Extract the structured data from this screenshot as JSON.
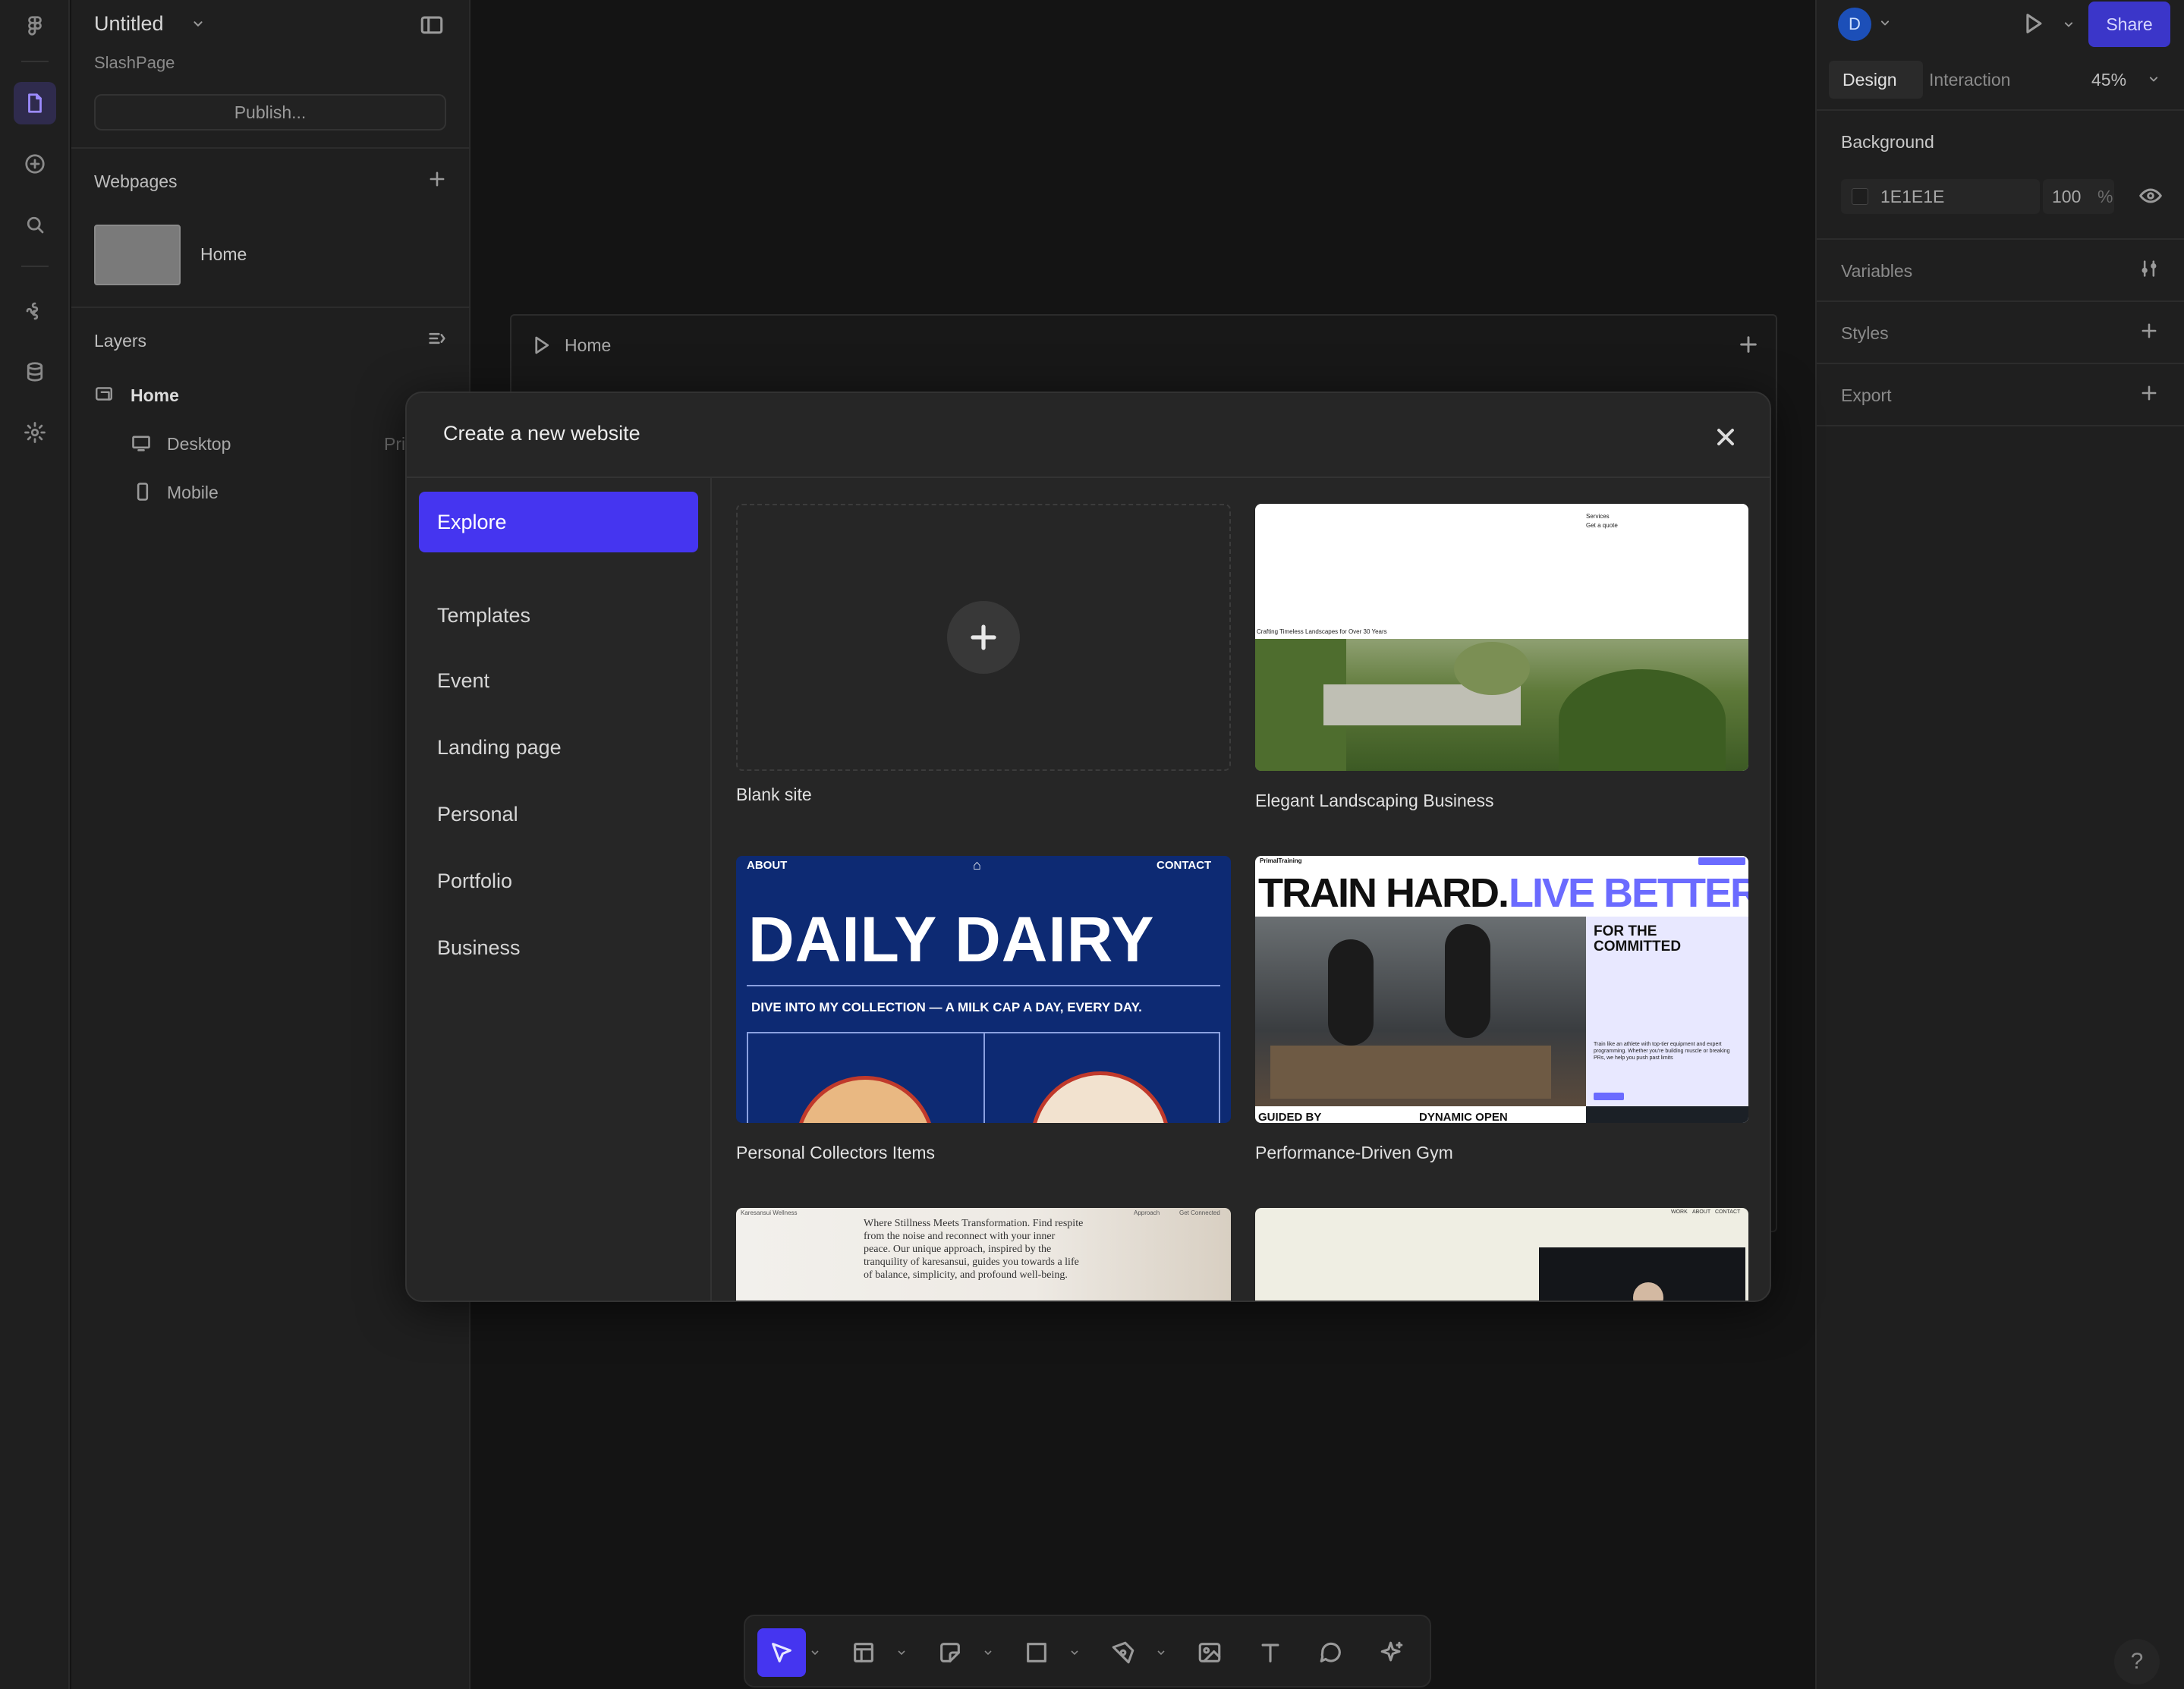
{
  "file": {
    "title": "Untitled",
    "team": "SlashPage",
    "publish_label": "Publish..."
  },
  "webpages": {
    "heading": "Webpages",
    "items": [
      {
        "label": "Home"
      }
    ]
  },
  "layers": {
    "heading": "Layers",
    "root": "Home",
    "children": [
      {
        "label": "Desktop",
        "badge": "Pri"
      },
      {
        "label": "Mobile"
      }
    ]
  },
  "right_panel": {
    "avatar_initial": "D",
    "share_label": "Share",
    "tabs": [
      {
        "label": "Design"
      },
      {
        "label": "Interaction"
      }
    ],
    "zoom": "45%",
    "background": {
      "heading": "Background",
      "hex": "1E1E1E",
      "opacity": "100",
      "unit": "%"
    },
    "sections": [
      {
        "label": "Variables"
      },
      {
        "label": "Styles"
      },
      {
        "label": "Export"
      }
    ]
  },
  "canvas": {
    "frame_label": "Home"
  },
  "modal": {
    "title": "Create a new website",
    "categories": [
      {
        "label": "Explore"
      },
      {
        "label": "Templates"
      },
      {
        "label": "Event"
      },
      {
        "label": "Landing page"
      },
      {
        "label": "Personal"
      },
      {
        "label": "Portfolio"
      },
      {
        "label": "Business"
      }
    ],
    "cards": [
      {
        "label": "Blank site"
      },
      {
        "label": "Elegant Landscaping Business"
      },
      {
        "label": "Personal Collectors Items"
      },
      {
        "label": "Performance-Driven Gym"
      }
    ],
    "previews": {
      "landscaping": {
        "nav1": "Services",
        "nav2": "Get a quote",
        "tagline": "Crafting Timeless Landscapes for Over 30 Years"
      },
      "dairy": {
        "about": "ABOUT",
        "contact": "CONTACT",
        "headline": "DAILY DAIRY",
        "subline": "DIVE INTO MY COLLECTION — A MILK CAP A DAY, EVERY DAY."
      },
      "gym": {
        "brand": "PrimalTraining",
        "headline_a": "TRAIN HARD.",
        "headline_b": "LIVE BETTER",
        "side_title": "FOR THE COMMITTED",
        "bottom1": "GUIDED BY",
        "bottom2": "DYNAMIC OPEN",
        "body": "Train like an athlete with top-tier equipment and expert programming. Whether you're building muscle or breaking PRs, we help you push past limits"
      },
      "wellness": {
        "brand": "Karesansui Wellness",
        "nav1": "Approach",
        "nav2": "Get Connected",
        "text": "Where Stillness Meets Transformation. Find respite from the noise and reconnect with your inner peace. Our unique approach, inspired by the tranquility of karesansui, guides you towards a life of balance, simplicity, and profound well-being."
      },
      "sixth": {
        "nav1": "WORK",
        "nav2": "ABOUT",
        "nav3": "CONTACT"
      }
    }
  },
  "colors": {
    "accent": "#4535f0",
    "share": "#3b36c9",
    "dairy_blue": "#0d2a73",
    "gym_accent": "#6b6bff"
  },
  "toolbar": {
    "tools": [
      "select-icon",
      "frame-icon",
      "shape-icon",
      "rectangle-icon",
      "pen-icon",
      "image-icon",
      "text-icon",
      "comment-icon",
      "ai-icon"
    ]
  },
  "help_label": "?"
}
